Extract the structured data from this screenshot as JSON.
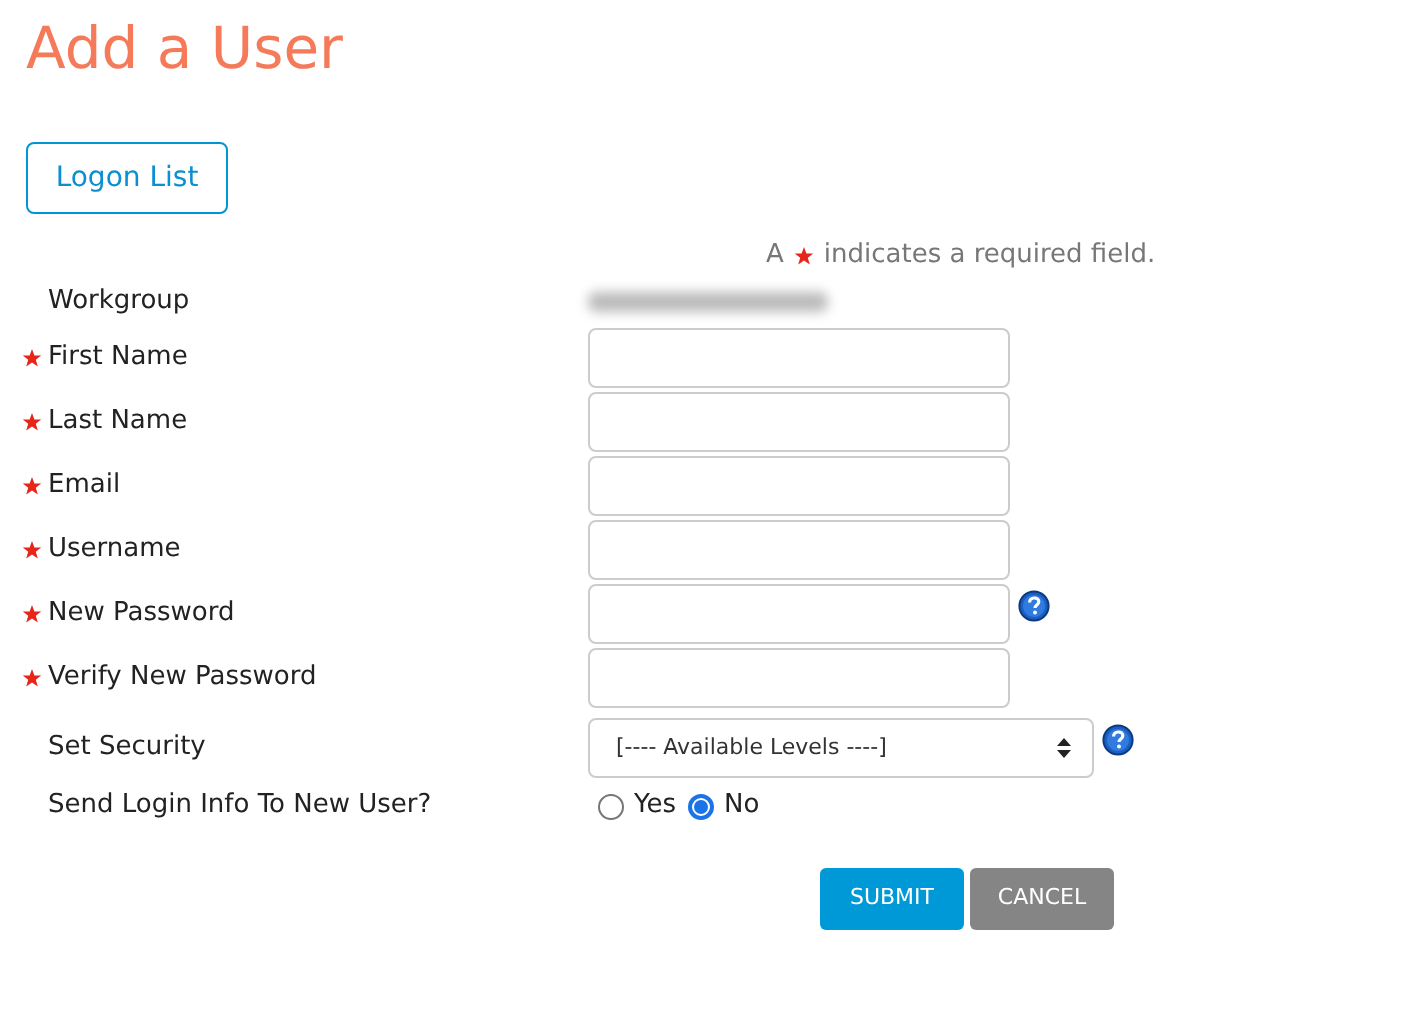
{
  "title": "Add a User",
  "logon_list_button": "Logon List",
  "required_note": {
    "before": "A",
    "after": "indicates a required field."
  },
  "fields": [
    {
      "kind": "static",
      "label": "Workgroup",
      "required": false,
      "redacted": true
    },
    {
      "kind": "text",
      "label": "First Name",
      "required": true,
      "help": false
    },
    {
      "kind": "text",
      "label": "Last Name",
      "required": true,
      "help": false
    },
    {
      "kind": "text",
      "label": "Email",
      "required": true,
      "help": false
    },
    {
      "kind": "text",
      "label": "Username",
      "required": true,
      "help": false
    },
    {
      "kind": "password",
      "label": "New Password",
      "required": true,
      "help": true
    },
    {
      "kind": "password",
      "label": "Verify New Password",
      "required": true,
      "help": false
    },
    {
      "kind": "select",
      "label": "Set Security",
      "required": false,
      "help": true,
      "value": "[---- Available Levels ----]"
    },
    {
      "kind": "radio",
      "label": "Send Login Info To New User?",
      "required": false,
      "options": [
        {
          "label": "Yes",
          "selected": false
        },
        {
          "label": "No",
          "selected": true
        }
      ]
    }
  ],
  "buttons": [
    {
      "label": "SUBMIT",
      "kind": "primary"
    },
    {
      "label": "CANCEL",
      "kind": "secondary"
    }
  ]
}
